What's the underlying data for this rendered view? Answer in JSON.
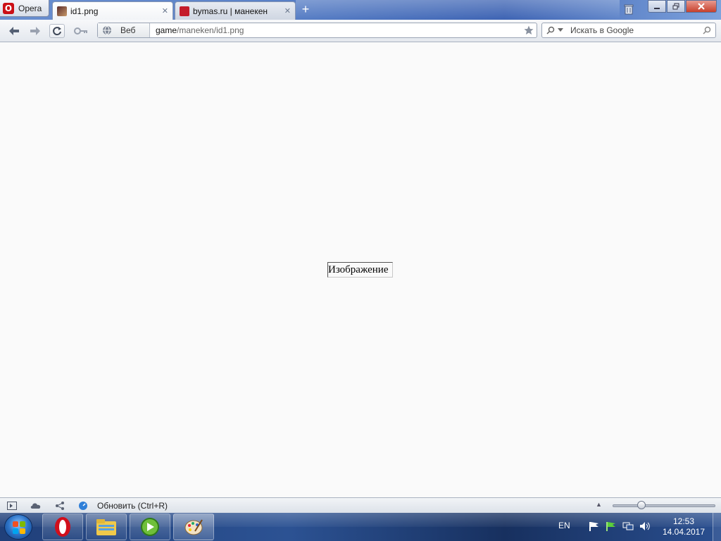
{
  "browser": {
    "menu_label": "Opera",
    "tabs": [
      {
        "title": "id1.png",
        "active": true
      },
      {
        "title": "bymas.ru | манекен",
        "active": false
      }
    ],
    "new_tab_symbol": "+",
    "close_symbol": "✕"
  },
  "toolbar": {
    "security_label": "Веб",
    "url_host": "game",
    "url_path": "/maneken/id1.png",
    "search_placeholder": "Искать в Google"
  },
  "page": {
    "image_alt": "Изображение"
  },
  "statusbar": {
    "status_text": "Обновить (Ctrl+R)",
    "zoom_percent": 100
  },
  "taskbar": {
    "language": "EN",
    "time": "12:53",
    "date": "14.04.2017"
  },
  "colors": {
    "opera_red": "#cc0f16",
    "accent_blue": "#2c5293"
  },
  "icons": {
    "back": "back-arrow-icon",
    "forward": "forward-arrow-icon",
    "reload": "reload-icon",
    "key": "key-icon",
    "globe": "globe-icon",
    "star": "bookmark-star-icon",
    "search": "search-icon"
  }
}
